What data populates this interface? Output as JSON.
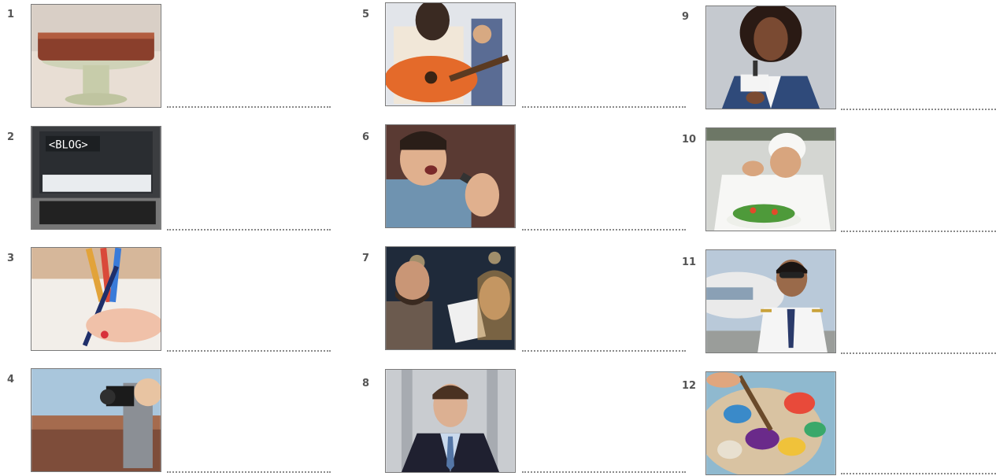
{
  "exercise": {
    "items": [
      {
        "number": "1",
        "image": "cake-on-stand"
      },
      {
        "number": "2",
        "image": "laptop-blog"
      },
      {
        "number": "3",
        "image": "hand-writing"
      },
      {
        "number": "4",
        "image": "photographer-canyon"
      },
      {
        "number": "5",
        "image": "woman-guitar"
      },
      {
        "number": "6",
        "image": "man-singing"
      },
      {
        "number": "7",
        "image": "actors-script"
      },
      {
        "number": "8",
        "image": "businessman-suit"
      },
      {
        "number": "9",
        "image": "reporter-microphone"
      },
      {
        "number": "10",
        "image": "chef-salad"
      },
      {
        "number": "11",
        "image": "pilot-airplane"
      },
      {
        "number": "12",
        "image": "paint-palette"
      }
    ]
  }
}
